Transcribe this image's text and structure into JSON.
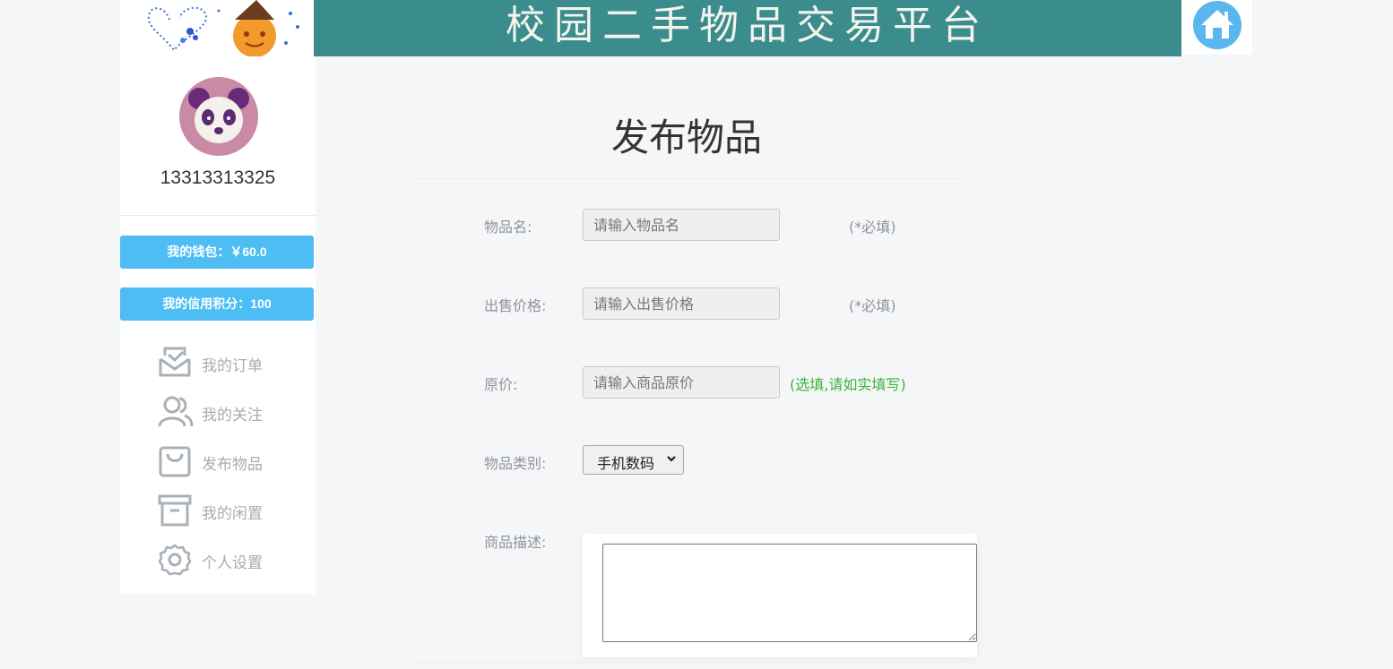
{
  "header": {
    "title": "校园二手物品交易平台",
    "logo_icon": "heart-pumpkin-logo",
    "home_icon": "home-icon",
    "brand_color": "#3a8d8c"
  },
  "sidebar": {
    "username": "13313313325",
    "wallet_label": "我的钱包：￥60.0",
    "credit_label": "我的信用积分：100",
    "accent_color": "#4dbdf4",
    "menu": [
      {
        "label": "我的订单",
        "icon": "envelope-icon"
      },
      {
        "label": "我的关注",
        "icon": "users-icon"
      },
      {
        "label": "发布物品",
        "icon": "shopping-bag-icon"
      },
      {
        "label": "我的闲置",
        "icon": "archive-box-icon"
      },
      {
        "label": "个人设置",
        "icon": "gear-icon"
      }
    ]
  },
  "form": {
    "title": "发布物品",
    "name_label": "物品名:",
    "name_placeholder": "请输入物品名",
    "name_hint": "(*必填)",
    "price_label": "出售价格:",
    "price_placeholder": "请输入出售价格",
    "price_hint": "(*必填)",
    "orig_label": "原价:",
    "orig_placeholder": "请输入商品原价",
    "orig_hint": "(选填,请如实填写)",
    "category_label": "物品类别:",
    "category_value": "手机数码",
    "desc_label": "商品描述:",
    "desc_value": ""
  }
}
